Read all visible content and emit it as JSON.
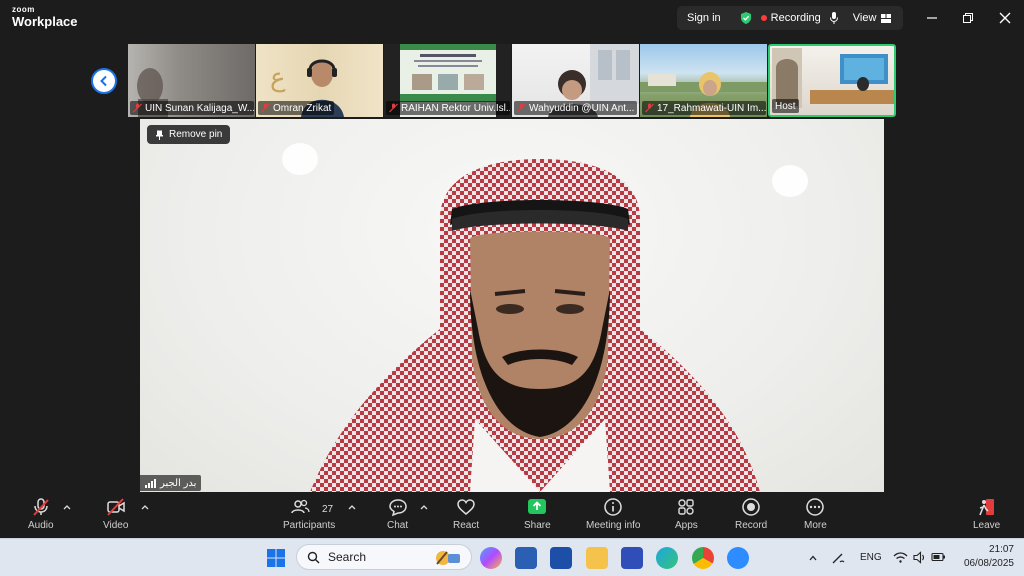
{
  "window": {
    "logo_line1": "zoom",
    "logo_line2": "Workplace",
    "sign_in": "Sign in",
    "recording": "Recording",
    "view": "View",
    "colors": {
      "shield": "#2ecc71",
      "record_dot": "#ff3b3b",
      "active_border": "#2ecc71",
      "accent_blue": "#1a73e8"
    }
  },
  "thumbnails": [
    {
      "name": "UIN Sunan Kalijaga_W..."
    },
    {
      "name": "Omran Zrikat"
    },
    {
      "name": "RAIHAN Rektor Univ.Isl..."
    },
    {
      "name": "Wahyuddin @UIN Ant..."
    },
    {
      "name": "17_Rahmawati-UIN Im..."
    },
    {
      "name": "Host"
    }
  ],
  "main": {
    "remove_pin": "Remove pin",
    "speaker_name": "بدر الجبر"
  },
  "toolbar": {
    "audio": "Audio",
    "video": "Video",
    "participants": "Participants",
    "participants_count": "27",
    "chat": "Chat",
    "react": "React",
    "share": "Share",
    "meeting_info": "Meeting info",
    "apps": "Apps",
    "record": "Record",
    "more": "More",
    "leave": "Leave"
  },
  "taskbar": {
    "search_placeholder": "Search",
    "language": "ENG",
    "time": "21:07",
    "date": "06/08/2025"
  }
}
